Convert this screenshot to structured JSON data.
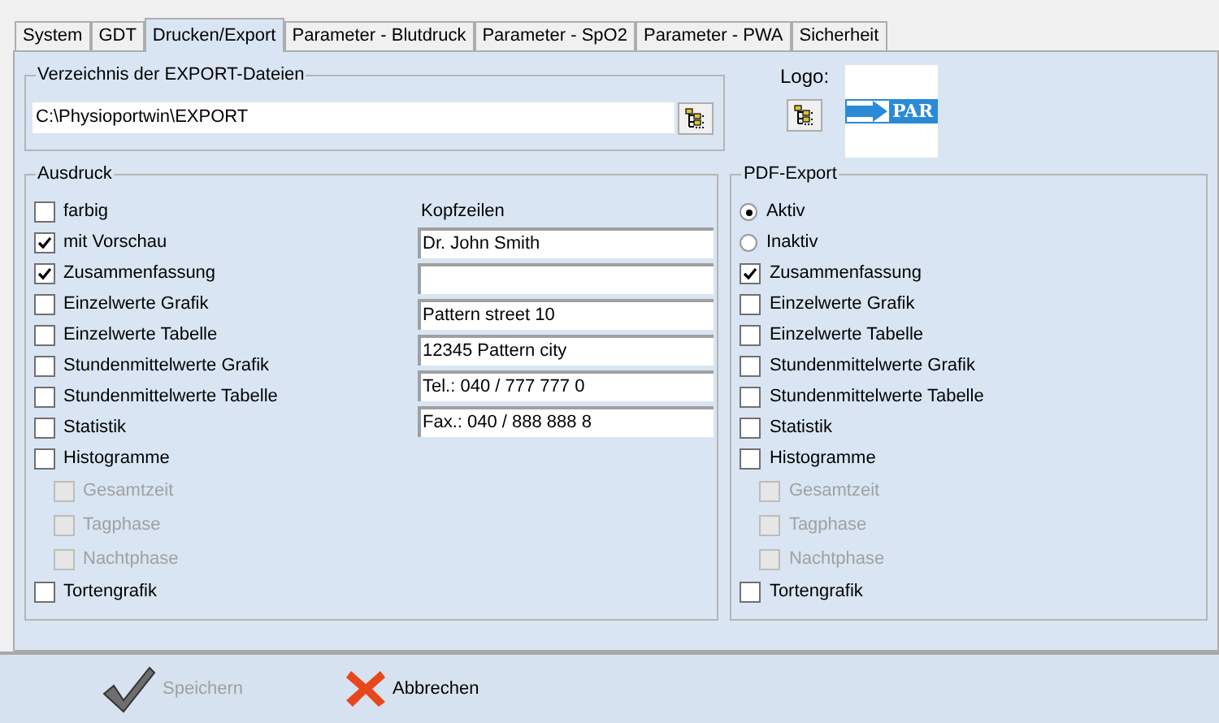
{
  "tabs": [
    {
      "label": "System",
      "selected": false
    },
    {
      "label": "GDT",
      "selected": false
    },
    {
      "label": "Drucken/Export",
      "selected": true
    },
    {
      "label": "Parameter - Blutdruck",
      "selected": false
    },
    {
      "label": "Parameter - SpO2",
      "selected": false
    },
    {
      "label": "Parameter - PWA",
      "selected": false
    },
    {
      "label": "Sicherheit",
      "selected": false
    }
  ],
  "export_dir": {
    "title": "Verzeichnis der EXPORT-Dateien",
    "value": "C:\\Physioportwin\\EXPORT"
  },
  "logo": {
    "label": "Logo:",
    "logo_text": "PAR"
  },
  "ausdruck": {
    "title": "Ausdruck",
    "items": [
      {
        "kind": "checkbox",
        "label": "farbig",
        "checked": false,
        "disabled": false
      },
      {
        "kind": "checkbox",
        "label": "mit Vorschau",
        "checked": true,
        "disabled": false
      },
      {
        "kind": "checkbox",
        "label": "Zusammenfassung",
        "checked": true,
        "disabled": false
      },
      {
        "kind": "checkbox",
        "label": "Einzelwerte Grafik",
        "checked": false,
        "disabled": false
      },
      {
        "kind": "checkbox",
        "label": "Einzelwerte Tabelle",
        "checked": false,
        "disabled": false
      },
      {
        "kind": "checkbox",
        "label": "Stundenmittelwerte Grafik",
        "checked": false,
        "disabled": false
      },
      {
        "kind": "checkbox",
        "label": "Stundenmittelwerte Tabelle",
        "checked": false,
        "disabled": false
      },
      {
        "kind": "checkbox",
        "label": "Statistik",
        "checked": false,
        "disabled": false
      },
      {
        "kind": "checkbox",
        "label": "Histogramme",
        "checked": false,
        "disabled": false,
        "children": [
          {
            "kind": "checkbox",
            "label": "Gesamtzeit",
            "checked": false,
            "disabled": true
          },
          {
            "kind": "checkbox",
            "label": "Tagphase",
            "checked": false,
            "disabled": true
          },
          {
            "kind": "checkbox",
            "label": "Nachtphase",
            "checked": false,
            "disabled": true
          }
        ]
      },
      {
        "kind": "checkbox",
        "label": "Tortengrafik",
        "checked": false,
        "disabled": false
      }
    ],
    "header_label": "Kopfzeilen",
    "header_lines": [
      {
        "kind": "text",
        "value": "Dr. John Smith"
      },
      {
        "kind": "blank"
      },
      {
        "kind": "text",
        "value": "Pattern street 10"
      },
      {
        "kind": "text",
        "value": "12345 Pattern city"
      },
      {
        "kind": "text",
        "value": "Tel.: 040 / 777 777 0"
      },
      {
        "kind": "text",
        "value": "Fax.: 040 / 888 888 8"
      }
    ]
  },
  "pdf_export": {
    "title": "PDF-Export",
    "items": [
      {
        "kind": "radio",
        "label": "Aktiv",
        "selected": true,
        "disabled": false
      },
      {
        "kind": "radio",
        "label": "Inaktiv",
        "selected": false,
        "disabled": false
      },
      {
        "kind": "checkbox",
        "label": "Zusammenfassung",
        "checked": true,
        "disabled": false
      },
      {
        "kind": "checkbox",
        "label": "Einzelwerte Grafik",
        "checked": false,
        "disabled": false
      },
      {
        "kind": "checkbox",
        "label": "Einzelwerte Tabelle",
        "checked": false,
        "disabled": false
      },
      {
        "kind": "checkbox",
        "label": "Stundenmittelwerte Grafik",
        "checked": false,
        "disabled": false
      },
      {
        "kind": "checkbox",
        "label": "Stundenmittelwerte Tabelle",
        "checked": false,
        "disabled": false
      },
      {
        "kind": "checkbox",
        "label": "Statistik",
        "checked": false,
        "disabled": false
      },
      {
        "kind": "checkbox",
        "label": "Histogramme",
        "checked": false,
        "disabled": false,
        "children": [
          {
            "kind": "checkbox",
            "label": "Gesamtzeit",
            "checked": false,
            "disabled": true
          },
          {
            "kind": "checkbox",
            "label": "Tagphase",
            "checked": false,
            "disabled": true
          },
          {
            "kind": "checkbox",
            "label": "Nachtphase",
            "checked": false,
            "disabled": true
          }
        ]
      },
      {
        "kind": "checkbox",
        "label": "Tortengrafik",
        "checked": false,
        "disabled": false
      }
    ]
  },
  "buttons": [
    {
      "kind": "save",
      "label": "Speichern",
      "disabled": true
    },
    {
      "kind": "cancel",
      "label": "Abbrechen",
      "disabled": false
    }
  ]
}
